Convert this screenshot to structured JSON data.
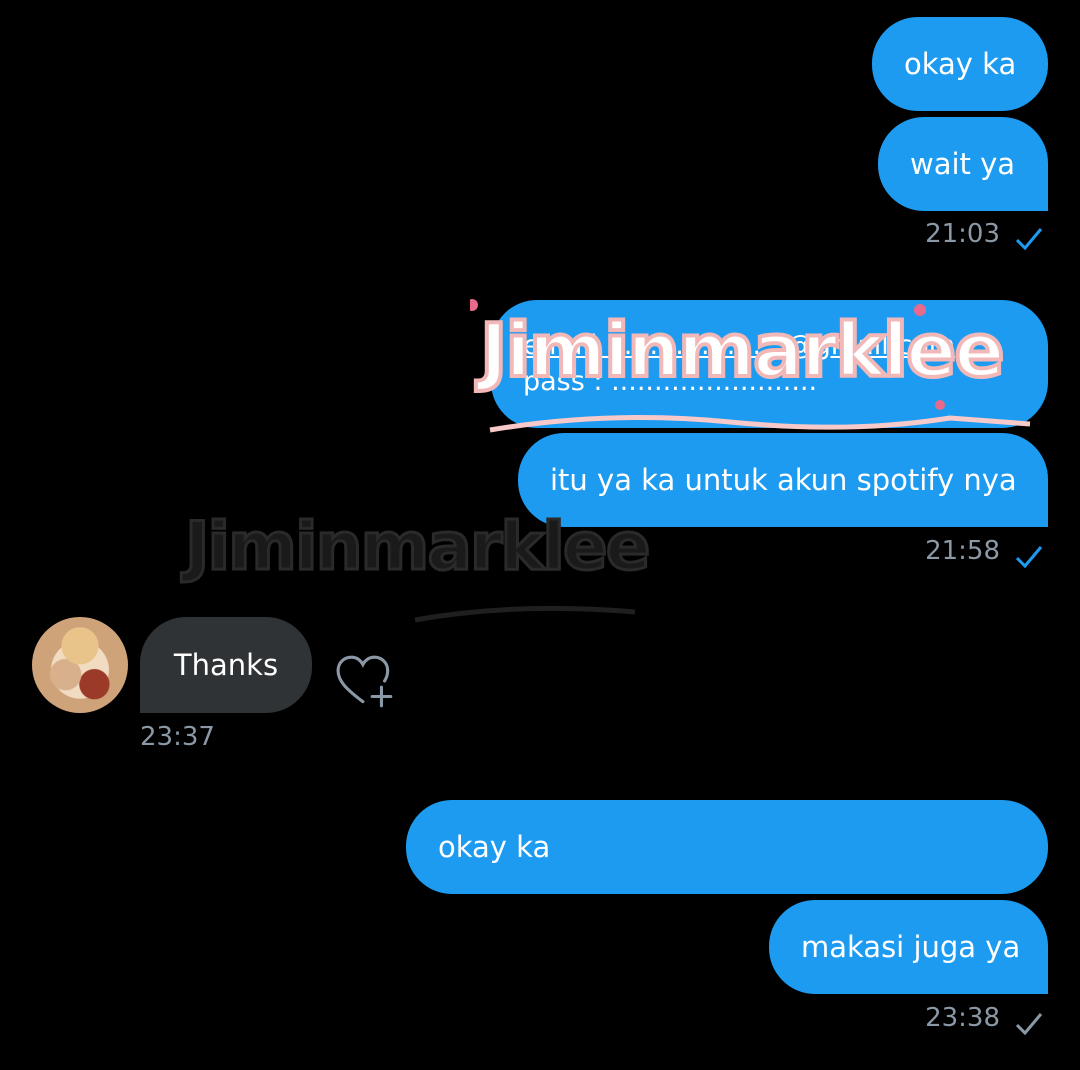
{
  "messages": [
    {
      "text": "okay ka"
    },
    {
      "text": "wait ya"
    },
    {
      "text": "email : ...................@gmail.com"
    },
    {
      "text": "pass : ........................"
    },
    {
      "text": "itu ya ka untuk akun spotify nya"
    },
    {
      "text": "Thanks"
    },
    {
      "text": "okay ka"
    },
    {
      "text": "makasi juga ya"
    }
  ],
  "timestamps": [
    "21:03",
    "21:58",
    "23:37",
    "23:38"
  ],
  "watermark": "Jiminmarklee",
  "icons": {
    "read_check": "check-icon",
    "react": "heart-plus-icon",
    "avatar": "user-avatar"
  },
  "colors": {
    "outgoing": "#1d9bf0",
    "incoming": "#2f3336",
    "timestamp": "#8b98a5",
    "background": "#000000"
  }
}
